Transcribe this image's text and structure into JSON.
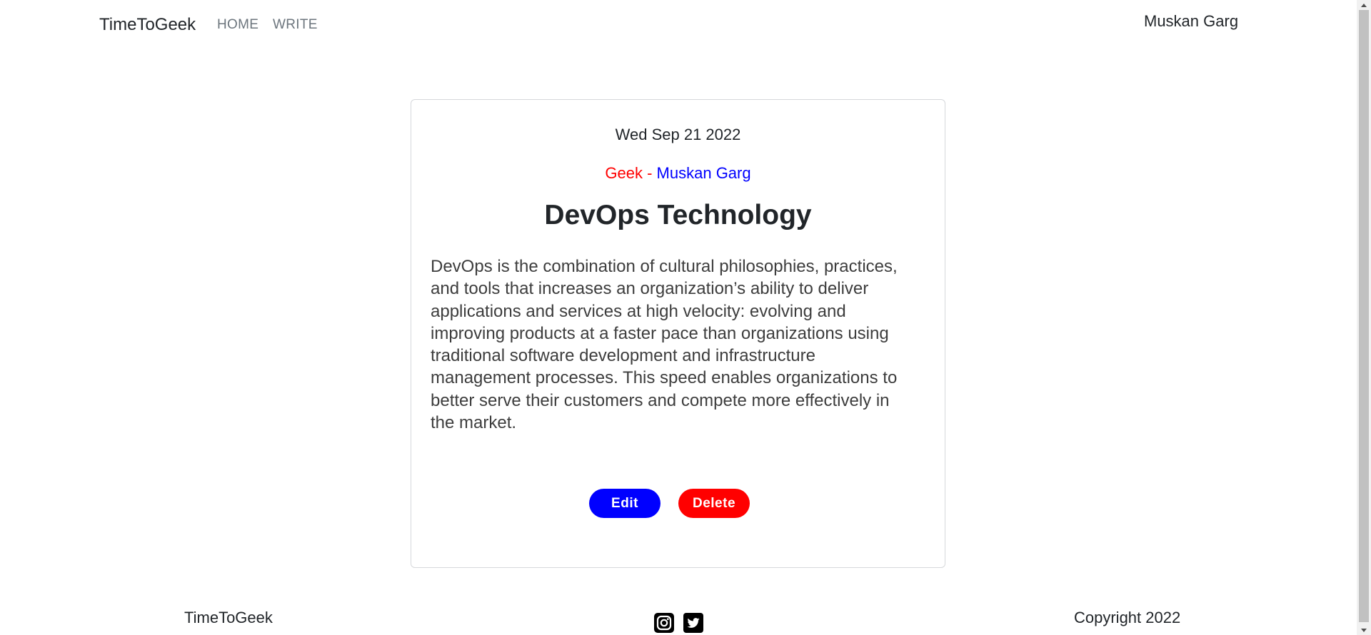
{
  "navbar": {
    "brand": "TimeToGeek",
    "links": [
      {
        "label": "HOME"
      },
      {
        "label": "WRITE"
      }
    ],
    "user": "Muskan Garg"
  },
  "post": {
    "date": "Wed Sep 21 2022",
    "category": "Geek",
    "separator": " - ",
    "author": "Muskan Garg",
    "title": "DevOps Technology",
    "body": "DevOps is the combination of cultural philosophies, practices, and tools that increases an organization’s ability to deliver applications and services at high velocity: evolving and improving products at a faster pace than organizations using traditional software development and infrastructure management processes. This speed enables organizations to better serve their customers and compete more effectively in the market.",
    "edit_label": "Edit",
    "delete_label": "Delete"
  },
  "footer": {
    "brand": "TimeToGeek",
    "social_icons": [
      "instagram-icon",
      "twitter-icon"
    ],
    "copyright": "Copyright 2022"
  },
  "colors": {
    "category": "#ff0000",
    "author": "#0000ff",
    "edit_button": "#0000ff",
    "delete_button": "#ff0000"
  }
}
